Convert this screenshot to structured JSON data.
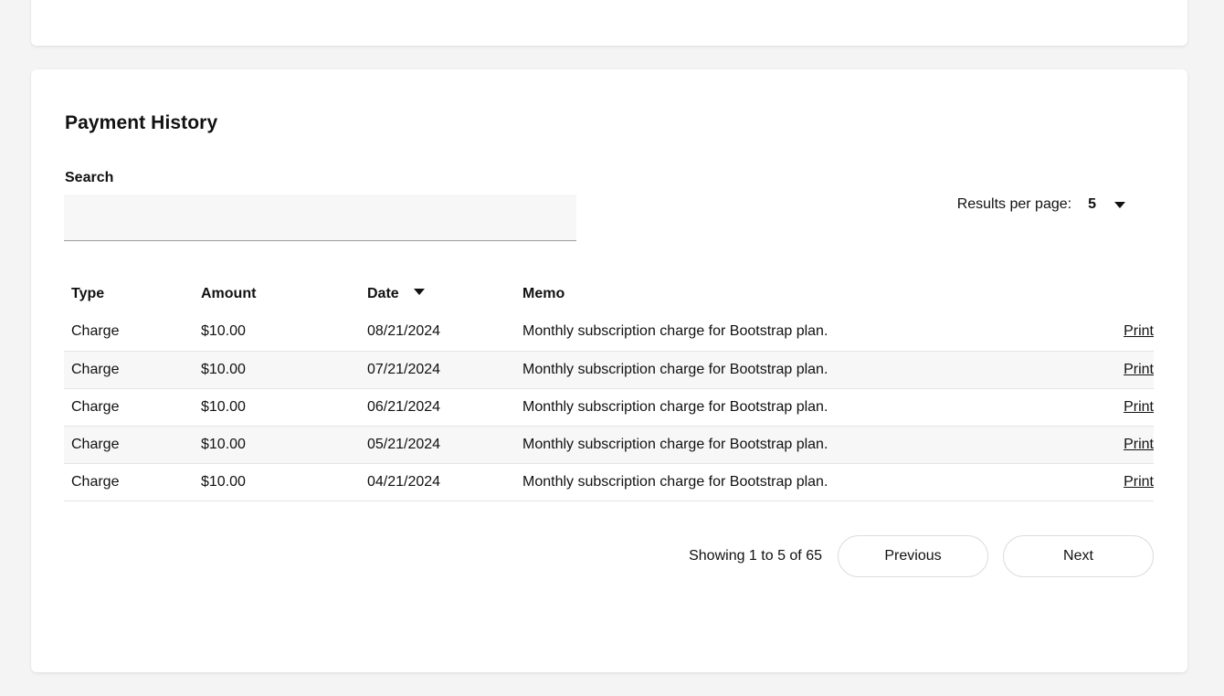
{
  "section": {
    "title": "Payment History"
  },
  "search": {
    "label": "Search",
    "value": "",
    "placeholder": ""
  },
  "results_per_page": {
    "label": "Results per page:",
    "value": "5"
  },
  "table": {
    "headers": {
      "type": "Type",
      "amount": "Amount",
      "date": "Date",
      "memo": "Memo"
    },
    "rows": [
      {
        "type": "Charge",
        "amount": "$10.00",
        "date": "08/21/2024",
        "memo": "Monthly subscription charge for Bootstrap plan.",
        "action": "Print"
      },
      {
        "type": "Charge",
        "amount": "$10.00",
        "date": "07/21/2024",
        "memo": "Monthly subscription charge for Bootstrap plan.",
        "action": "Print"
      },
      {
        "type": "Charge",
        "amount": "$10.00",
        "date": "06/21/2024",
        "memo": "Monthly subscription charge for Bootstrap plan.",
        "action": "Print"
      },
      {
        "type": "Charge",
        "amount": "$10.00",
        "date": "05/21/2024",
        "memo": "Monthly subscription charge for Bootstrap plan.",
        "action": "Print"
      },
      {
        "type": "Charge",
        "amount": "$10.00",
        "date": "04/21/2024",
        "memo": "Monthly subscription charge for Bootstrap plan.",
        "action": "Print"
      }
    ]
  },
  "pagination": {
    "status": "Showing 1 to 5 of 65",
    "previous_label": "Previous",
    "next_label": "Next"
  }
}
